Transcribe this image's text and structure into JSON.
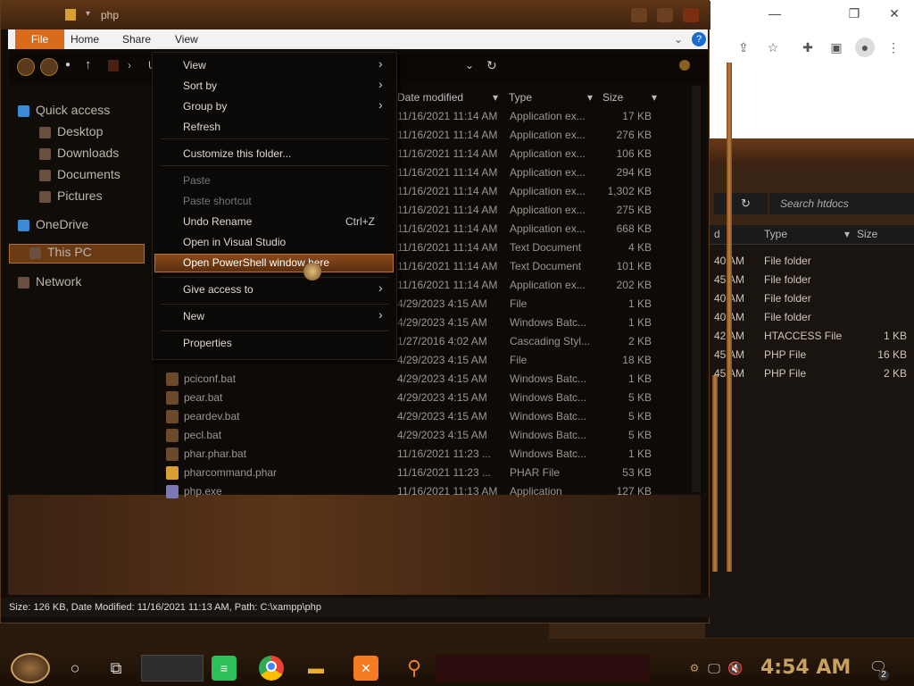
{
  "window": {
    "title": "php",
    "path_crumb": "U"
  },
  "ribbon": {
    "tabs": [
      "File",
      "Home",
      "Share",
      "View"
    ]
  },
  "chrome": {
    "min": "—",
    "restore": "❐",
    "close": "✕"
  },
  "sidebar": {
    "items": [
      {
        "label": "Quick access",
        "icon": "star-icon"
      },
      {
        "label": "Desktop",
        "icon": "desktop-icon"
      },
      {
        "label": "Downloads",
        "icon": "download-icon"
      },
      {
        "label": "Documents",
        "icon": "documents-icon"
      },
      {
        "label": "Pictures",
        "icon": "pictures-icon"
      },
      {
        "label": "OneDrive",
        "icon": "cloud-icon"
      },
      {
        "label": "This PC",
        "icon": "pc-icon"
      },
      {
        "label": "Network",
        "icon": "network-icon"
      }
    ]
  },
  "columns": {
    "date": "Date modified",
    "type": "Type",
    "size": "Size"
  },
  "files": [
    {
      "name": "",
      "date": "11/16/2021 11:14 AM",
      "type": "Application ex...",
      "size": "17 KB"
    },
    {
      "name": "",
      "date": "11/16/2021 11:14 AM",
      "type": "Application ex...",
      "size": "276 KB"
    },
    {
      "name": "",
      "date": "11/16/2021 11:14 AM",
      "type": "Application ex...",
      "size": "106 KB"
    },
    {
      "name": "",
      "date": "11/16/2021 11:14 AM",
      "type": "Application ex...",
      "size": "294 KB"
    },
    {
      "name": "",
      "date": "11/16/2021 11:14 AM",
      "type": "Application ex...",
      "size": "1,302 KB"
    },
    {
      "name": "",
      "date": "11/16/2021 11:14 AM",
      "type": "Application ex...",
      "size": "275 KB"
    },
    {
      "name": "",
      "date": "11/16/2021 11:14 AM",
      "type": "Application ex...",
      "size": "668 KB"
    },
    {
      "name": "",
      "date": "11/16/2021 11:14 AM",
      "type": "Text Document",
      "size": "4 KB"
    },
    {
      "name": "",
      "date": "11/16/2021 11:14 AM",
      "type": "Text Document",
      "size": "101 KB"
    },
    {
      "name": "",
      "date": "11/16/2021 11:14 AM",
      "type": "Application ex...",
      "size": "202 KB"
    },
    {
      "name": "",
      "date": "4/29/2023 4:15 AM",
      "type": "File",
      "size": "1 KB"
    },
    {
      "name": "",
      "date": "4/29/2023 4:15 AM",
      "type": "Windows Batc...",
      "size": "1 KB"
    },
    {
      "name": "",
      "date": "1/27/2016 4:02 AM",
      "type": "Cascading Styl...",
      "size": "2 KB"
    },
    {
      "name": "",
      "date": "4/29/2023 4:15 AM",
      "type": "File",
      "size": "18 KB"
    },
    {
      "name": "pciconf.bat",
      "date": "4/29/2023 4:15 AM",
      "type": "Windows Batc...",
      "size": "1 KB"
    },
    {
      "name": "pear.bat",
      "date": "4/29/2023 4:15 AM",
      "type": "Windows Batc...",
      "size": "5 KB"
    },
    {
      "name": "peardev.bat",
      "date": "4/29/2023 4:15 AM",
      "type": "Windows Batc...",
      "size": "5 KB"
    },
    {
      "name": "pecl.bat",
      "date": "4/29/2023 4:15 AM",
      "type": "Windows Batc...",
      "size": "5 KB"
    },
    {
      "name": "phar.phar.bat",
      "date": "11/16/2021 11:23 ...",
      "type": "Windows Batc...",
      "size": "1 KB"
    },
    {
      "name": "pharcommand.phar",
      "date": "11/16/2021 11:23 ...",
      "type": "PHAR File",
      "size": "53 KB"
    },
    {
      "name": "php.exe",
      "date": "11/16/2021 11:13 AM",
      "type": "Application",
      "size": "127 KB"
    }
  ],
  "menu": {
    "items": [
      {
        "label": "View",
        "submenu": true
      },
      {
        "label": "Sort by",
        "submenu": true
      },
      {
        "label": "Group by",
        "submenu": true
      },
      {
        "label": "Refresh"
      },
      {
        "label": "Customize this folder..."
      },
      {
        "label": "Paste",
        "disabled": true
      },
      {
        "label": "Paste shortcut",
        "disabled": true
      },
      {
        "label": "Undo Rename",
        "shortcut": "Ctrl+Z"
      },
      {
        "label": "Open in Visual Studio"
      },
      {
        "label": "Open PowerShell window here",
        "highlighted": true
      },
      {
        "label": "Give access to",
        "submenu": true
      },
      {
        "label": "New",
        "submenu": true
      },
      {
        "label": "Properties"
      }
    ]
  },
  "status": {
    "text": "Size: 126 KB, Date Modified: 11/16/2021 11:13 AM, Path: C:\\xampp\\php"
  },
  "explorer2": {
    "search_placeholder": "Search htdocs",
    "columns": {
      "date": "d",
      "type": "Type",
      "size": "Size"
    },
    "rows": [
      {
        "time": "40 AM",
        "type": "File folder",
        "size": ""
      },
      {
        "time": "45 AM",
        "type": "File folder",
        "size": ""
      },
      {
        "time": "40 AM",
        "type": "File folder",
        "size": ""
      },
      {
        "time": "40 AM",
        "type": "File folder",
        "size": ""
      },
      {
        "time": "42 AM",
        "type": "HTACCESS File",
        "size": "1 KB"
      },
      {
        "time": "45 AM",
        "type": "PHP File",
        "size": "16 KB"
      },
      {
        "time": "45 AM",
        "type": "PHP File",
        "size": "2 KB"
      }
    ]
  },
  "taskbar": {
    "time": "4:54 AM",
    "notifications": "2"
  },
  "colors": {
    "accent": "#d96c1a",
    "highlight": "#8a4a1a",
    "clock": "#c8a060"
  }
}
